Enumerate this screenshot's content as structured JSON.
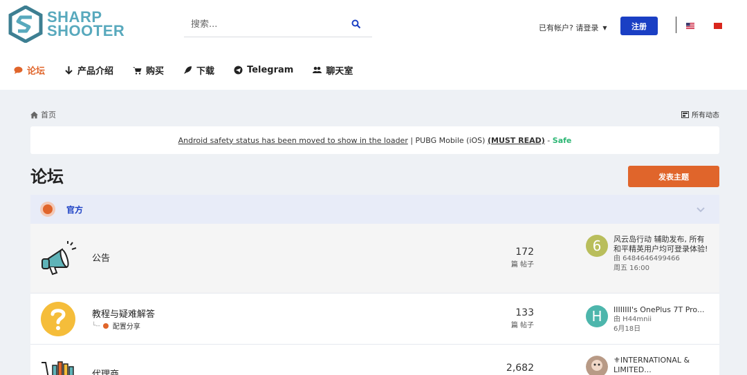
{
  "brand": {
    "line1": "SHARP",
    "line2": "SHOOTER"
  },
  "search": {
    "placeholder": "搜索..."
  },
  "account": {
    "login_label": "已有帐户? 请登录",
    "register_label": "注册"
  },
  "nav": [
    {
      "label": "论坛",
      "icon": "chat-bubble-icon",
      "active": true
    },
    {
      "label": "产品介绍",
      "icon": "arrow-down-icon"
    },
    {
      "label": "购买",
      "icon": "cart-icon"
    },
    {
      "label": "下载",
      "icon": "rocket-icon"
    },
    {
      "label": "Telegram",
      "icon": "telegram-icon"
    },
    {
      "label": "聊天室",
      "icon": "users-icon"
    }
  ],
  "breadcrumb": {
    "home_label": "首页"
  },
  "activity_label": "所有动态",
  "announcement": {
    "link_text": "Android safety status has been moved to show in the loader",
    "separator": " | PUBG Mobile (iOS) ",
    "must_read": "(MUST READ)",
    "dash": " - ",
    "status": "Safe"
  },
  "page": {
    "title": "论坛",
    "new_topic_label": "发表主题"
  },
  "category": {
    "title": "官方"
  },
  "forums": [
    {
      "title": "公告",
      "count": "172",
      "count_label": "篇 帖子",
      "last_avatar_letter": "6",
      "last_avatar_color": "#b9be5c",
      "last_title": "风云岛行动 辅助发布, 所有和平精英用户均可登录体验!",
      "last_by": "由 6484646499466",
      "last_time": "周五 16:00"
    },
    {
      "title": "教程与疑难解答",
      "subforum": "配置分享",
      "count": "133",
      "count_label": "篇 帖子",
      "last_avatar_letter": "H",
      "last_avatar_color": "#4db6ac",
      "last_title": "IIIIIIII's OnePlus 7T Pro...",
      "last_by": "由 H44mnii",
      "last_time": "6月18日"
    },
    {
      "title": "代理商",
      "count": "2,682",
      "last_title": "⚜INTERNATIONAL & LIMITED..."
    }
  ],
  "colors": {
    "accent": "#e0652b",
    "primary": "#1a3fc4",
    "safe": "#2bb673",
    "brand": "#58a9bd"
  }
}
